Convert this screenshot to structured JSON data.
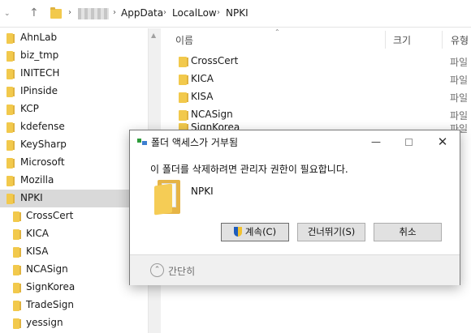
{
  "address_bar": {
    "crumbs": [
      "AppData",
      "LocalLow",
      "NPKI"
    ]
  },
  "nav_pane": {
    "items": [
      {
        "label": "AhnLab",
        "level": 0,
        "selected": false
      },
      {
        "label": "biz_tmp",
        "level": 0,
        "selected": false
      },
      {
        "label": "INITECH",
        "level": 0,
        "selected": false
      },
      {
        "label": "IPinside",
        "level": 0,
        "selected": false
      },
      {
        "label": "KCP",
        "level": 0,
        "selected": false
      },
      {
        "label": "kdefense",
        "level": 0,
        "selected": false
      },
      {
        "label": "KeySharp",
        "level": 0,
        "selected": false
      },
      {
        "label": "Microsoft",
        "level": 0,
        "selected": false
      },
      {
        "label": "Mozilla",
        "level": 0,
        "selected": false
      },
      {
        "label": "NPKI",
        "level": 0,
        "selected": true
      },
      {
        "label": "CrossCert",
        "level": 1,
        "selected": false
      },
      {
        "label": "KICA",
        "level": 1,
        "selected": false
      },
      {
        "label": "KISA",
        "level": 1,
        "selected": false
      },
      {
        "label": "NCASign",
        "level": 1,
        "selected": false
      },
      {
        "label": "SignKorea",
        "level": 1,
        "selected": false
      },
      {
        "label": "TradeSign",
        "level": 1,
        "selected": false
      },
      {
        "label": "yessign",
        "level": 1,
        "selected": false
      }
    ]
  },
  "file_list": {
    "columns": {
      "name": "이름",
      "size": "크기",
      "type": "유형"
    },
    "rows": [
      {
        "name": "CrossCert",
        "type": "파일"
      },
      {
        "name": "KICA",
        "type": "파일"
      },
      {
        "name": "KISA",
        "type": "파일"
      },
      {
        "name": "NCASign",
        "type": "파일"
      },
      {
        "name": "SignKorea",
        "type": "파일"
      }
    ]
  },
  "dialog": {
    "title": "폴더 액세스가 거부됨",
    "message": "이 폴더를 삭제하려면 관리자 권한이 필요합니다.",
    "folder_name": "NPKI",
    "buttons": {
      "continue": "계속(C)",
      "skip": "건너뛰기(S)",
      "cancel": "취소"
    },
    "footer_label": "간단히"
  },
  "colors": {
    "selected_bg": "#d9d9d9",
    "folder_yellow": "#f2c94c",
    "shield_blue": "#1f5dbc",
    "shield_yellow": "#f2c230"
  }
}
